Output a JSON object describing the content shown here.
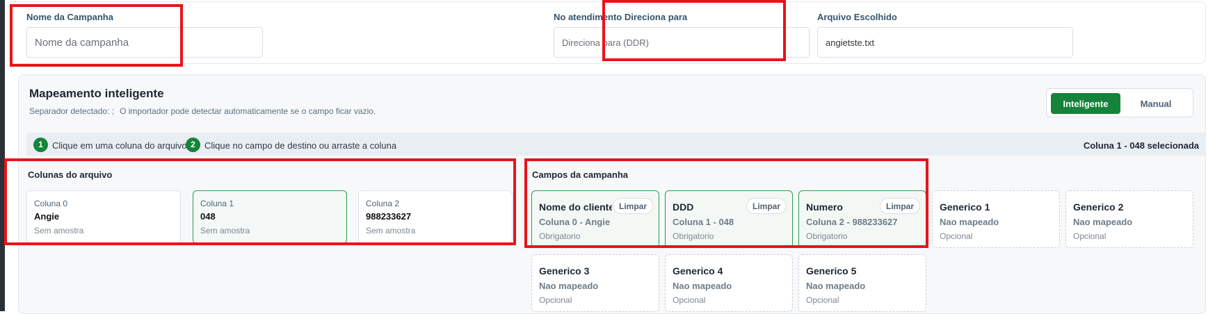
{
  "campaign": {
    "name_label": "Nome da Campanha",
    "name_placeholder": "Nome da campanha",
    "redirect_label": "No atendimento Direciona para",
    "redirect_placeholder": "Direciona para (DDR)",
    "file_label": "Arquivo Escolhido",
    "file_value": "angietste.txt"
  },
  "mapping": {
    "title": "Mapeamento inteligente",
    "separator_text": "Separador detectado: ;",
    "hint_text": "O importador pode detectar automaticamente se o campo ficar vazio.",
    "modes": [
      {
        "label": "Inteligente",
        "active": true
      },
      {
        "label": "Manual",
        "active": false
      }
    ],
    "steps": [
      {
        "num": "1",
        "text": "Clique em uma coluna do arquivo"
      },
      {
        "num": "2",
        "text": "Clique no campo de destino ou arraste a coluna"
      }
    ],
    "selected_info": "Coluna 1 - 048 selecionada",
    "file_columns_title": "Colunas do arquivo",
    "file_columns": [
      {
        "name": "Coluna 0",
        "value": "Angie",
        "sample": "Sem amostra",
        "selected": false
      },
      {
        "name": "Coluna 1",
        "value": "048",
        "sample": "Sem amostra",
        "selected": true
      },
      {
        "name": "Coluna 2",
        "value": "988233627",
        "sample": "Sem amostra",
        "selected": false
      }
    ],
    "campaign_fields_title": "Campos da campanha",
    "clear_label": "Limpar",
    "campaign_fields": [
      {
        "title": "Nome do cliente",
        "mapped_to": "Coluna 0 - Angie",
        "status": "Obrigatorio",
        "mapped": true
      },
      {
        "title": "DDD",
        "mapped_to": "Coluna 1 - 048",
        "status": "Obrigatorio",
        "mapped": true
      },
      {
        "title": "Numero",
        "mapped_to": "Coluna 2 - 988233627",
        "status": "Obrigatorio",
        "mapped": true
      },
      {
        "title": "Generico 1",
        "mapped_to": "Nao mapeado",
        "status": "Opcional",
        "mapped": false
      },
      {
        "title": "Generico 2",
        "mapped_to": "Nao mapeado",
        "status": "Opcional",
        "mapped": false
      },
      {
        "title": "Generico 3",
        "mapped_to": "Nao mapeado",
        "status": "Opcional",
        "mapped": false
      },
      {
        "title": "Generico 4",
        "mapped_to": "Nao mapeado",
        "status": "Opcional",
        "mapped": false
      },
      {
        "title": "Generico 5",
        "mapped_to": "Nao mapeado",
        "status": "Opcional",
        "mapped": false
      }
    ]
  },
  "colors": {
    "accent": "#16833a",
    "mapped_border": "#2c9a51",
    "highlight": "#e8141a"
  }
}
